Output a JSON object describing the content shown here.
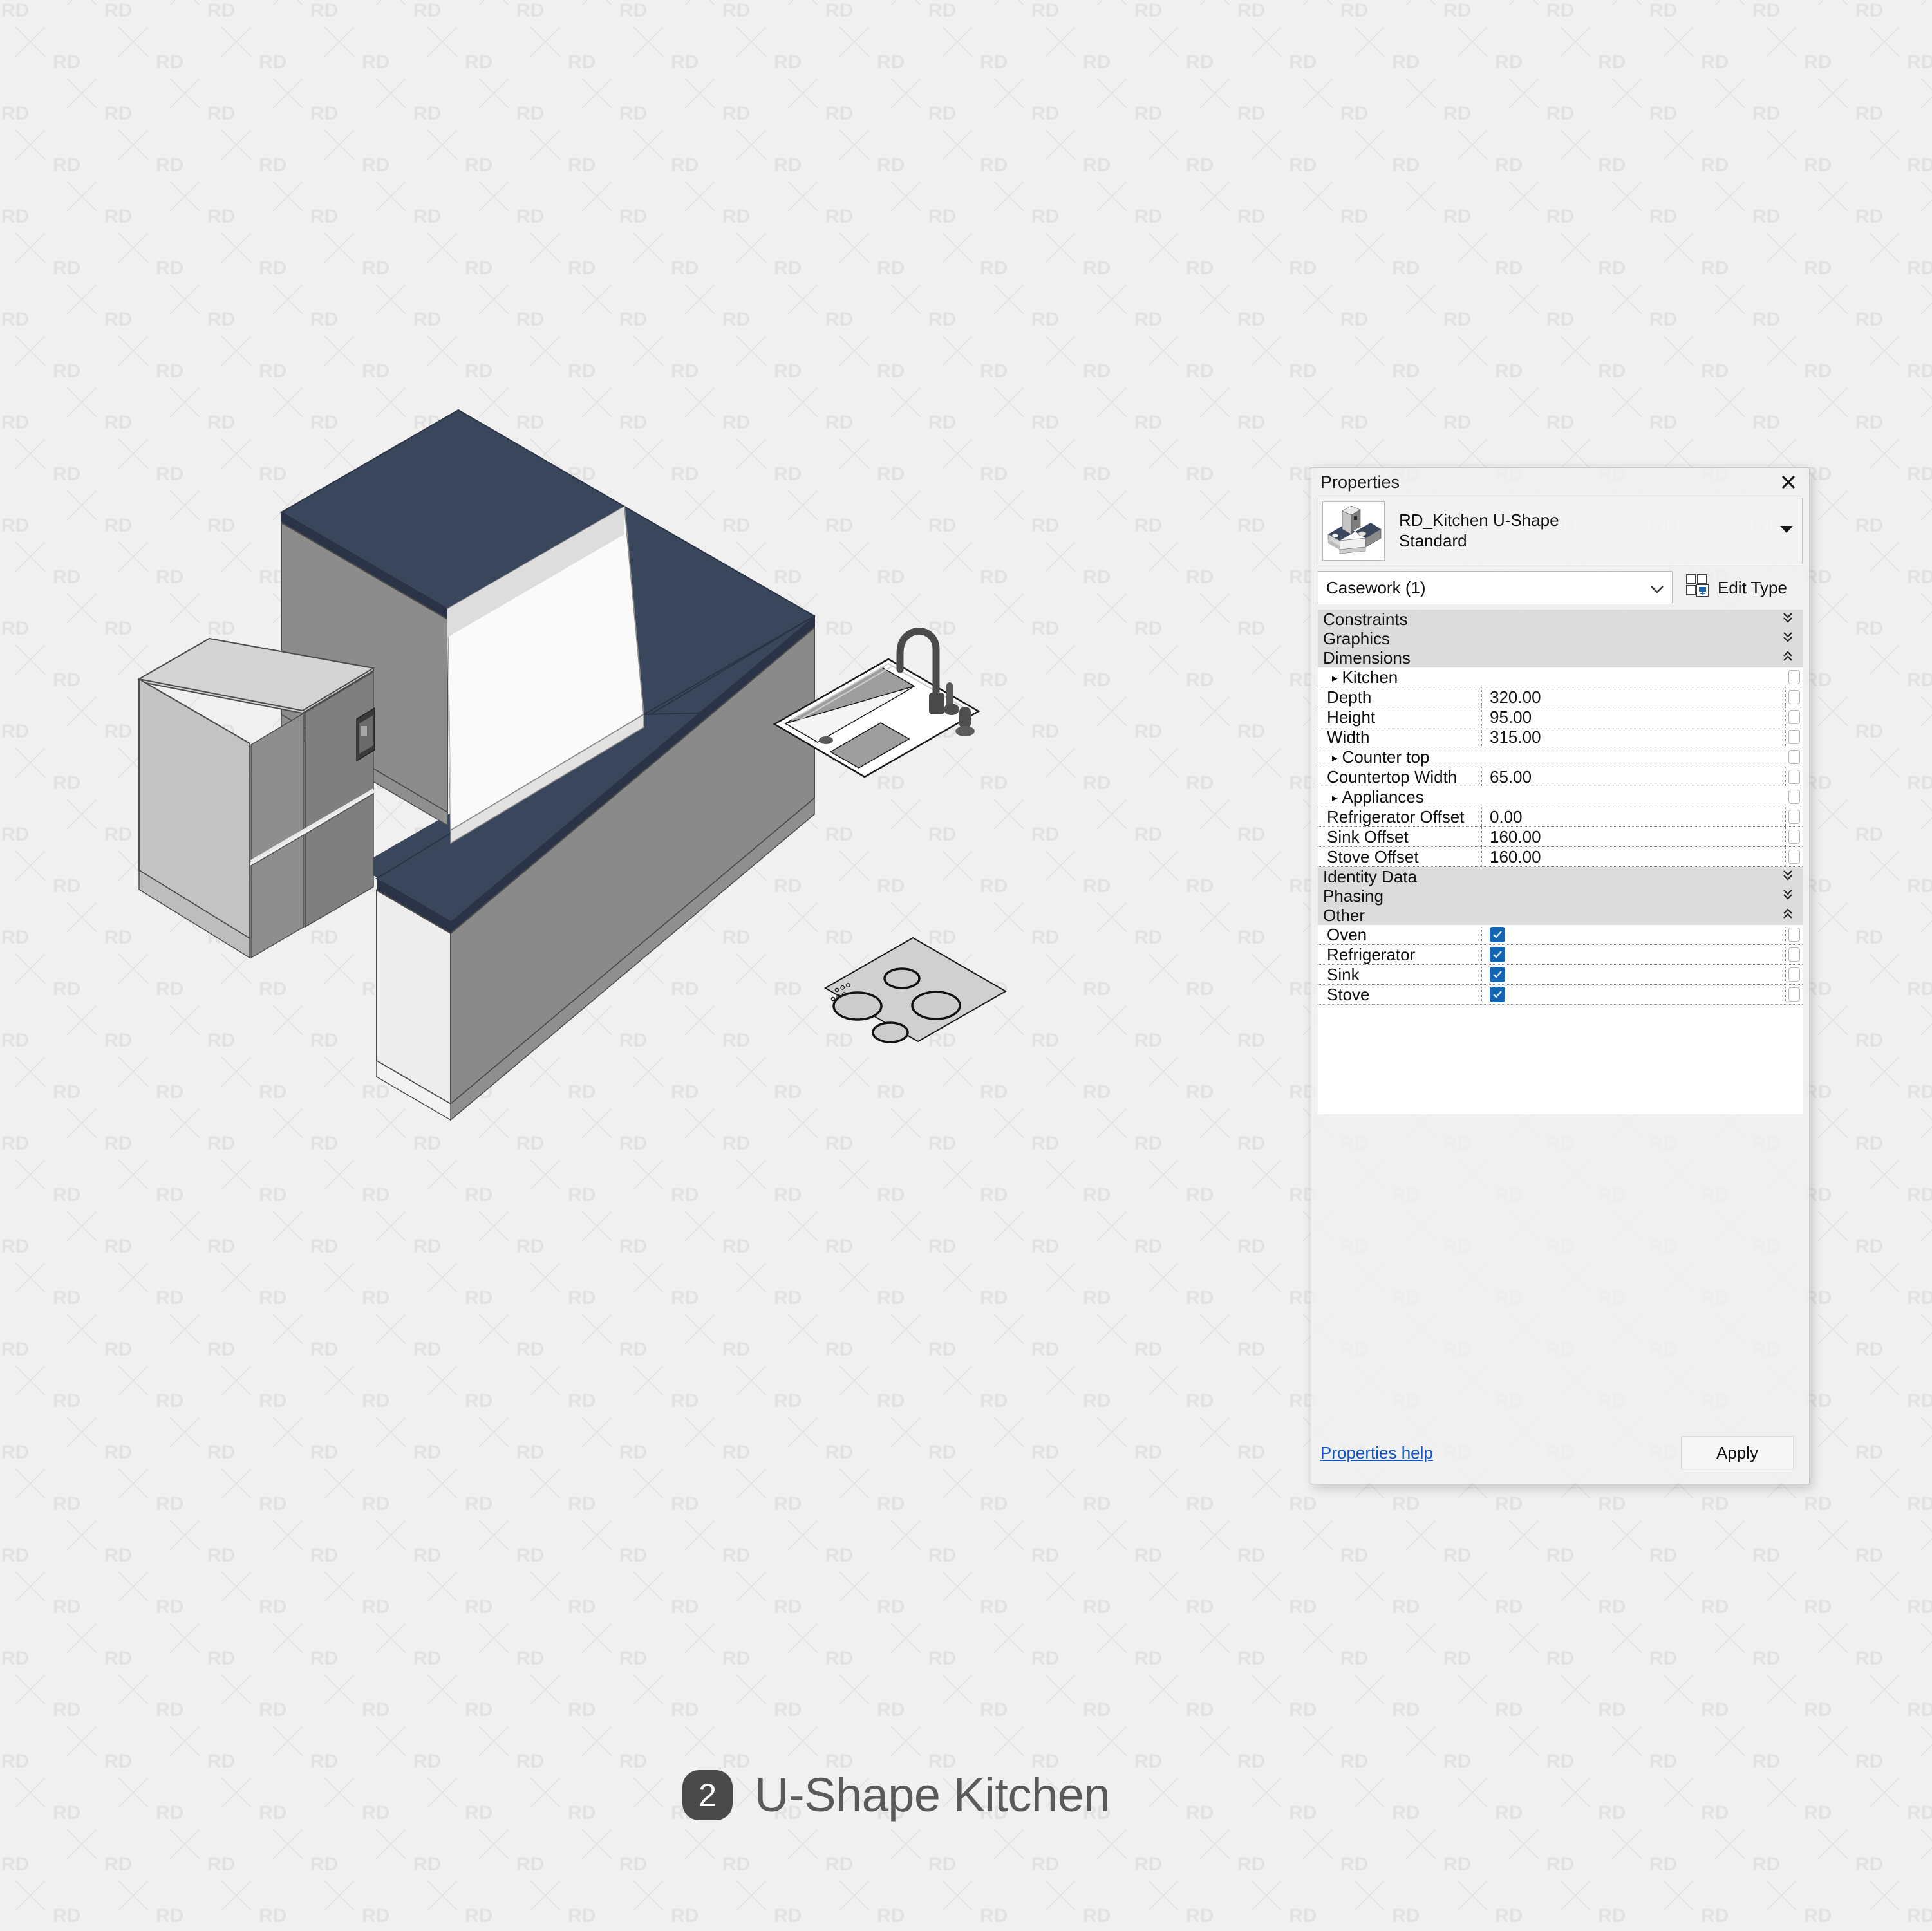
{
  "watermark": {
    "text": "RD"
  },
  "caption": {
    "number": "2",
    "title": "U-Shape Kitchen"
  },
  "properties": {
    "title": "Properties",
    "close_icon": "close-icon",
    "type_name": "RD_Kitchen U-Shape",
    "type_variant": "Standard",
    "category_select": "Casework (1)",
    "edit_type_label": "Edit Type",
    "groups": [
      {
        "label": "Constraints",
        "state": "collapsed",
        "chevron": "»"
      },
      {
        "label": "Graphics",
        "state": "collapsed",
        "chevron": "»"
      },
      {
        "label": "Dimensions",
        "state": "expanded",
        "chevron": "«"
      }
    ],
    "dimensions_rows": [
      {
        "name": "Kitchen",
        "value": "",
        "sub": true,
        "type": "text"
      },
      {
        "name": "Depth",
        "value": "320.00",
        "sub": false,
        "type": "text"
      },
      {
        "name": "Height",
        "value": "95.00",
        "sub": false,
        "type": "text"
      },
      {
        "name": "Width",
        "value": "315.00",
        "sub": false,
        "type": "text"
      },
      {
        "name": "Counter top",
        "value": "",
        "sub": true,
        "type": "text"
      },
      {
        "name": "Countertop Width",
        "value": "65.00",
        "sub": false,
        "type": "text"
      },
      {
        "name": "Appliances",
        "value": "",
        "sub": true,
        "type": "text"
      },
      {
        "name": "Refrigerator Offset",
        "value": "0.00",
        "sub": false,
        "type": "text"
      },
      {
        "name": "Sink Offset",
        "value": "160.00",
        "sub": false,
        "type": "text"
      },
      {
        "name": "Stove Offset",
        "value": "160.00",
        "sub": false,
        "type": "text"
      }
    ],
    "groups_tail": [
      {
        "label": "Identity Data",
        "state": "collapsed",
        "chevron": "»"
      },
      {
        "label": "Phasing",
        "state": "collapsed",
        "chevron": "»"
      },
      {
        "label": "Other",
        "state": "expanded",
        "chevron": "«"
      }
    ],
    "other_rows": [
      {
        "name": "Oven",
        "value": "",
        "checked": true,
        "type": "checkbox"
      },
      {
        "name": "Refrigerator",
        "value": "",
        "checked": true,
        "type": "checkbox"
      },
      {
        "name": "Sink",
        "value": "",
        "checked": true,
        "type": "checkbox"
      },
      {
        "name": "Stove",
        "value": "",
        "checked": true,
        "type": "checkbox"
      }
    ],
    "help_link": "Properties help",
    "apply_label": "Apply",
    "colors": {
      "checkbox_blue": "#1464b4",
      "link_blue": "#1455c0",
      "group_header_bg": "#dcdcdc",
      "panel_bg": "#f0f0f0"
    }
  },
  "model": {
    "countertop_color": "#3a465c",
    "countertop_edge_color": "#2b3446",
    "cabinet_light": "#eeeeee",
    "cabinet_mid": "#8c8c8c",
    "cabinet_dark": "#7d7d7d",
    "appliance_light": "#c9c9c9",
    "appliance_mid": "#8a8a8a",
    "fridge_body": "#b9b9b9",
    "fixture_dark": "#4a4a4a"
  }
}
